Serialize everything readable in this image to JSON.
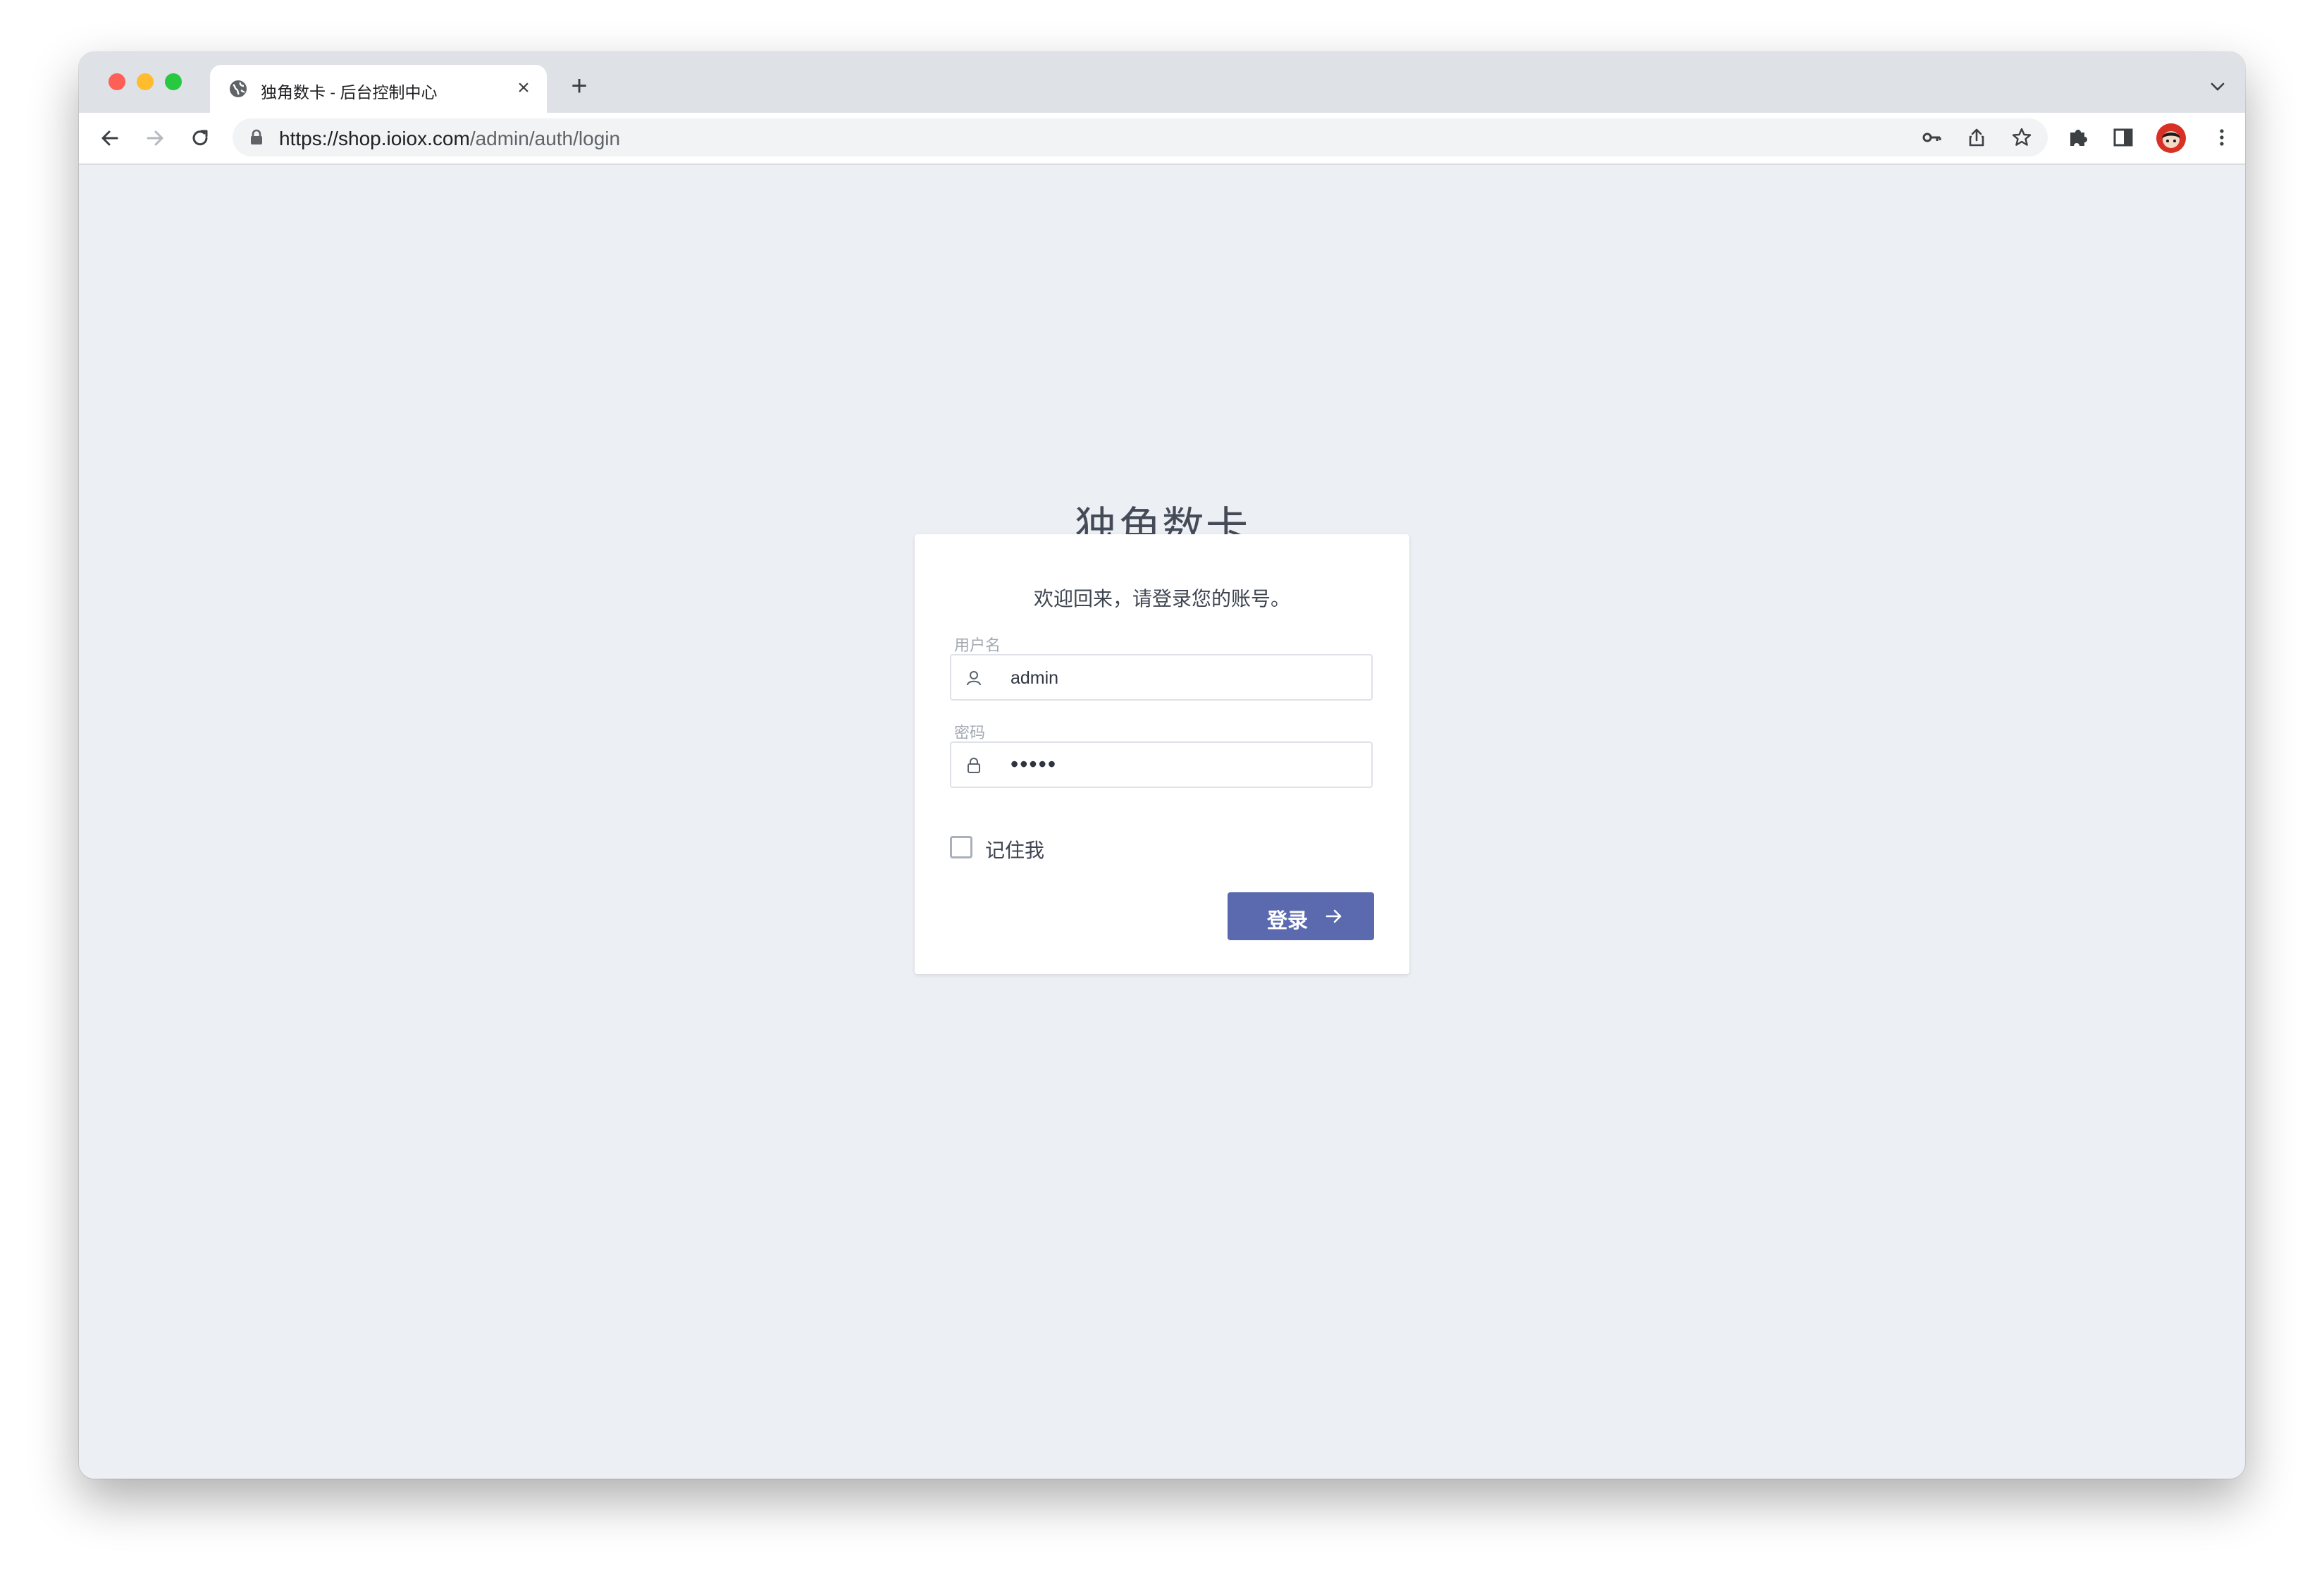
{
  "browser": {
    "tab_title": "独角数卡 - 后台控制中心",
    "url_host": "https://shop.ioiox.com",
    "url_path": "/admin/auth/login",
    "new_tab_glyph": "+",
    "close_glyph": "×"
  },
  "page": {
    "brand": "独角数卡",
    "welcome": "欢迎回来，请登录您的账号。",
    "username_label": "用户名",
    "username_value": "admin",
    "password_label": "密码",
    "password_value": "•••••",
    "remember_label": "记住我",
    "login_label": "登录"
  },
  "colors": {
    "page_bg": "#eceff4",
    "accent": "#5b6aae",
    "tabbar_bg": "#dee1e6"
  },
  "icons": {
    "favicon": "globe-icon",
    "username": "user-icon",
    "password": "lock-icon",
    "login": "arrow-right-icon"
  }
}
